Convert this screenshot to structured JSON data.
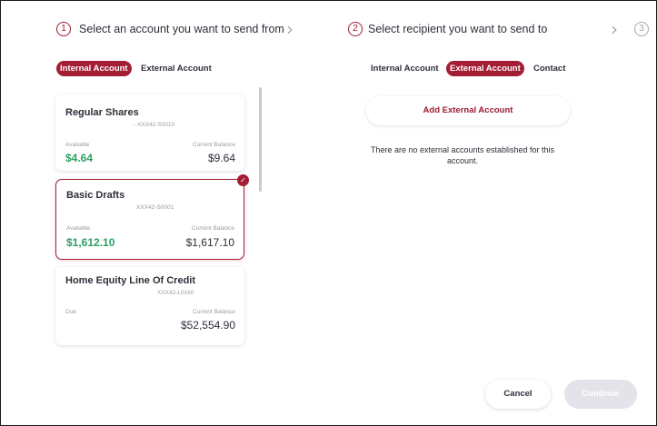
{
  "step1": {
    "number": "1",
    "label": "Select an account you want to send from"
  },
  "step2": {
    "number": "2",
    "label": "Select recipient you want to send to"
  },
  "step3": {
    "number": "3"
  },
  "source_tabs": [
    {
      "label": "Internal Account",
      "active": true
    },
    {
      "label": "External Account",
      "active": false
    }
  ],
  "recipient_tabs": [
    {
      "label": "Internal Account",
      "active": false
    },
    {
      "label": "External Account",
      "active": true
    },
    {
      "label": "Contact",
      "active": false
    }
  ],
  "accounts": [
    {
      "name": "Regular Shares",
      "number": "- XXX42-S0010",
      "left_label": "Available",
      "left_value": "$4.64",
      "right_label": "Current Balance",
      "right_value": "$9.64",
      "selected": false
    },
    {
      "name": "Basic Drafts",
      "number": "XXX42-S0001",
      "left_label": "Available",
      "left_value": "$1,612.10",
      "right_label": "Current Balance",
      "right_value": "$1,617.10",
      "selected": true
    },
    {
      "name": "Home Equity Line Of Credit",
      "number": "XXX42-L0160",
      "left_label": "Due",
      "left_value": "",
      "right_label": "Current Balance",
      "right_value": "$52,554.90",
      "selected": false
    }
  ],
  "recipient": {
    "add_button": "Add External Account",
    "empty_message": "There are no external accounts established for this account."
  },
  "footer": {
    "cancel": "Cancel",
    "continue": "Continue"
  },
  "icons": {
    "chevron": "chevron-right-icon",
    "check": "check-icon"
  },
  "colors": {
    "accent": "#a31d33",
    "positive": "#2f9e63",
    "disabled": "#e3e3e9"
  }
}
